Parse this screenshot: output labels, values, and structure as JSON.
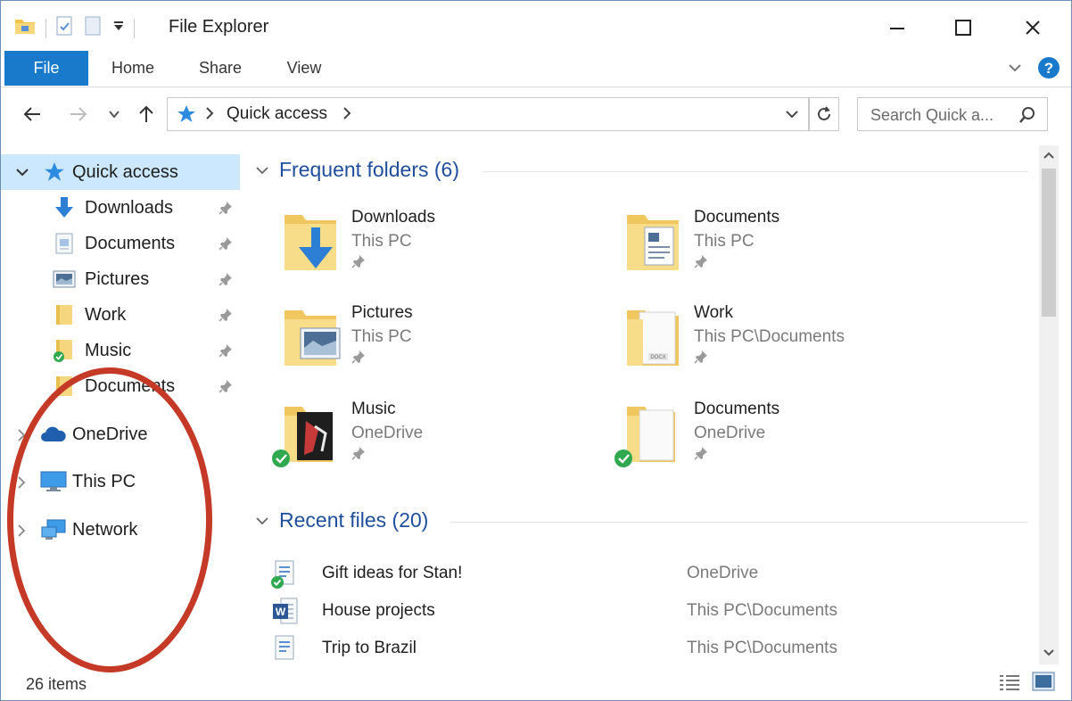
{
  "window": {
    "title": "File Explorer"
  },
  "ribbon": {
    "tabs": [
      "File",
      "Home",
      "Share",
      "View"
    ]
  },
  "address": {
    "path": [
      "Quick access"
    ]
  },
  "search": {
    "placeholder": "Search Quick a..."
  },
  "nav": {
    "quick_access": "Quick access",
    "pinned": [
      {
        "label": "Downloads",
        "icon": "downloads-icon"
      },
      {
        "label": "Documents",
        "icon": "documents-icon"
      },
      {
        "label": "Pictures",
        "icon": "pictures-icon"
      },
      {
        "label": "Work",
        "icon": "folder-icon"
      },
      {
        "label": "Music",
        "icon": "music-folder-icon"
      },
      {
        "label": "Documents",
        "icon": "folder-icon"
      }
    ],
    "roots": [
      {
        "label": "OneDrive",
        "icon": "onedrive-icon"
      },
      {
        "label": "This PC",
        "icon": "computer-icon"
      },
      {
        "label": "Network",
        "icon": "network-icon"
      }
    ]
  },
  "content": {
    "frequent_header": "Frequent folders (6)",
    "frequent": [
      {
        "name": "Downloads",
        "location": "This PC"
      },
      {
        "name": "Documents",
        "location": "This PC"
      },
      {
        "name": "Pictures",
        "location": "This PC"
      },
      {
        "name": "Work",
        "location": "This PC\\Documents"
      },
      {
        "name": "Music",
        "location": "OneDrive"
      },
      {
        "name": "Documents",
        "location": "OneDrive"
      }
    ],
    "recent_header": "Recent files (20)",
    "recent": [
      {
        "name": "Gift ideas for Stan!",
        "location": "OneDrive"
      },
      {
        "name": "House projects",
        "location": "This PC\\Documents"
      },
      {
        "name": "Trip to Brazil",
        "location": "This PC\\Documents"
      }
    ]
  },
  "status": {
    "items": "26 items"
  },
  "colors": {
    "accent": "#1979ca",
    "header_blue": "#1f4e9c",
    "annotation": "#c43a26"
  }
}
